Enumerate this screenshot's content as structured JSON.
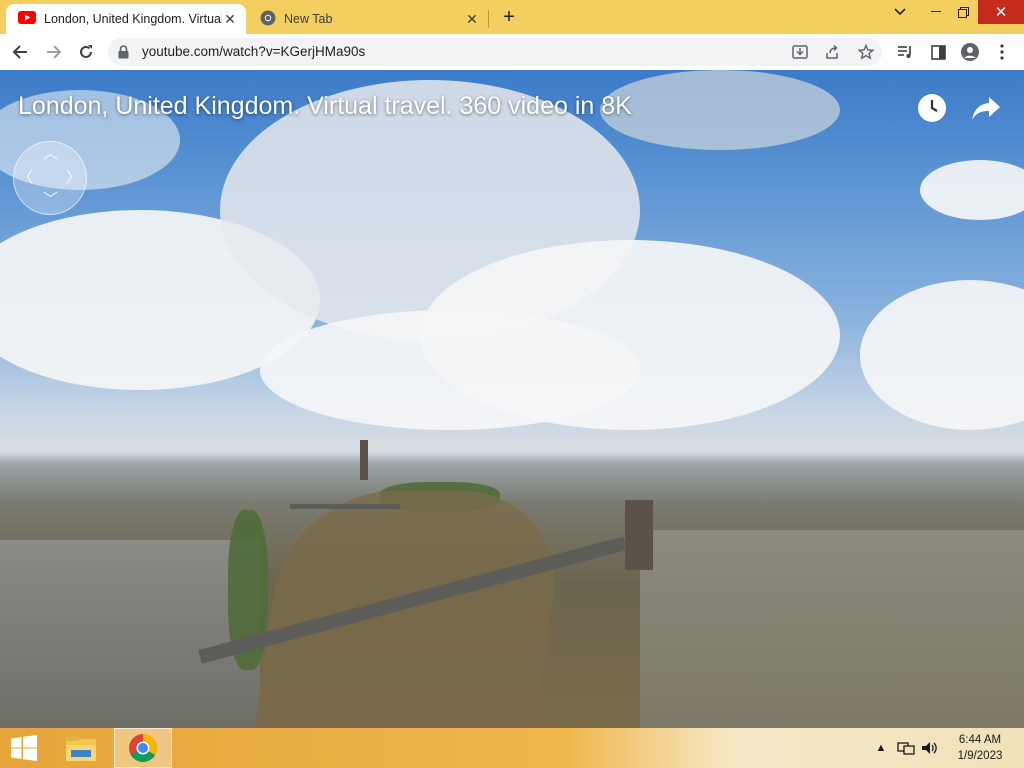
{
  "browser": {
    "tabs": [
      {
        "title": "London, United Kingdom. Virtual travel. 360 video in 8K",
        "active": true,
        "icon": "youtube-icon"
      },
      {
        "title": "New Tab",
        "active": false,
        "icon": "chrome-icon"
      }
    ],
    "new_tab_symbol": "+",
    "url": "youtube.com/watch?v=KGerjHMa90s"
  },
  "video": {
    "title": "London, United Kingdom. Virtual travel. 360 video in 8K",
    "overlay_icons": [
      "watch-later-icon",
      "share-icon"
    ]
  },
  "taskbar": {
    "apps": [
      "windows-start-icon",
      "file-explorer-icon",
      "chrome-icon"
    ],
    "time": "6:44 AM",
    "date": "1/9/2023"
  },
  "colors": {
    "tabstrip": "#f3cf5f",
    "close_button": "#c42b1c",
    "youtube_red": "#ff0000"
  }
}
